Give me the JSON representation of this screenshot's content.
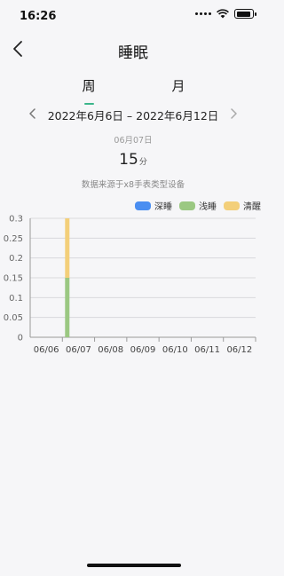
{
  "status": {
    "time": "16:26"
  },
  "header": {
    "title": "睡眠"
  },
  "tabs": [
    {
      "label": "周"
    },
    {
      "label": "月"
    }
  ],
  "range": {
    "text": "2022年6月6日 – 2022年6月12日"
  },
  "selected": {
    "date": "06月07日",
    "duration_value": "15",
    "duration_unit": "分"
  },
  "source_text": "数据来源于x8手表类型设备",
  "legend": [
    {
      "label": "深睡",
      "color": "#4a8ef1"
    },
    {
      "label": "浅睡",
      "color": "#9bc882"
    },
    {
      "label": "清醒",
      "color": "#f3cf7a"
    }
  ],
  "colors": {
    "accent": "#3bb58b",
    "grid": "#d9d9dc",
    "axis": "#999999"
  },
  "chart_data": {
    "type": "bar",
    "stacked": true,
    "categories": [
      "06/06",
      "06/07",
      "06/08",
      "06/09",
      "06/10",
      "06/11",
      "06/12"
    ],
    "series": [
      {
        "name": "深睡",
        "values": [
          0,
          0,
          0,
          0,
          0,
          0,
          0
        ]
      },
      {
        "name": "浅睡",
        "values": [
          0,
          0.15,
          0,
          0,
          0,
          0,
          0
        ]
      },
      {
        "name": "清醒",
        "values": [
          0,
          0.15,
          0,
          0,
          0,
          0,
          0
        ]
      }
    ],
    "ylim": [
      0,
      0.3
    ],
    "yticks": [
      "0",
      "0.05",
      "0.1",
      "0.15",
      "0.2",
      "0.25",
      "0.3"
    ],
    "grid": true,
    "legend_position": "top-right"
  }
}
